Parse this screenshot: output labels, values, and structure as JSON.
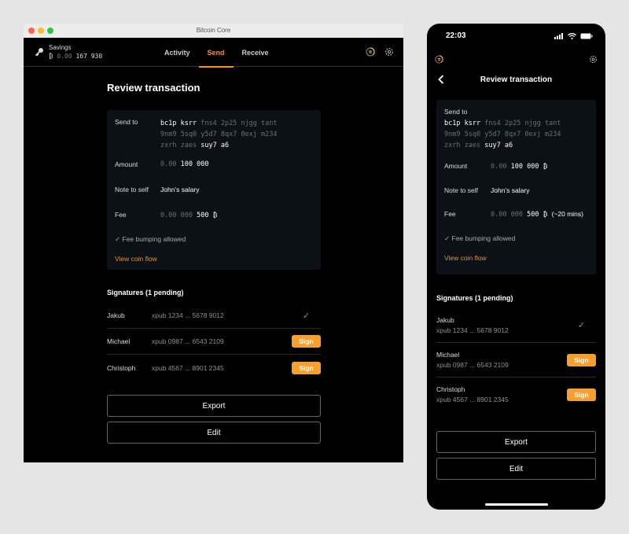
{
  "desktop": {
    "window_title": "Bitcoin Core",
    "wallet": {
      "name": "Savings",
      "balance_prefix": "₿",
      "balance_dim": "0.00",
      "balance_value": "167 930"
    },
    "tabs": [
      {
        "label": "Activity",
        "active": false
      },
      {
        "label": "Send",
        "active": true
      },
      {
        "label": "Receive",
        "active": false
      }
    ],
    "icons": {
      "network": "network-status-icon",
      "settings": "gear-icon"
    }
  },
  "phone": {
    "time": "22:03",
    "back_label": "‹"
  },
  "review": {
    "title": "Review transaction",
    "send_to_label": "Send to",
    "address": {
      "line1": [
        {
          "t": "bc1p",
          "hi": true
        },
        {
          "t": "ksrr",
          "hi": true
        },
        {
          "t": "fns4",
          "hi": false
        },
        {
          "t": "2p25",
          "hi": false
        },
        {
          "t": "njgg",
          "hi": false
        },
        {
          "t": "tant",
          "hi": false
        }
      ],
      "line2": [
        {
          "t": "9nm9",
          "hi": false
        },
        {
          "t": "5sq0",
          "hi": false
        },
        {
          "t": "y5d7",
          "hi": false
        },
        {
          "t": "8qx7",
          "hi": false
        },
        {
          "t": "0exj",
          "hi": false
        },
        {
          "t": "m234",
          "hi": false
        }
      ],
      "line3": [
        {
          "t": "zxrh",
          "hi": false
        },
        {
          "t": "zaes",
          "hi": false
        },
        {
          "t": "suy7",
          "hi": true
        },
        {
          "t": "a6",
          "hi": true
        }
      ]
    },
    "amount_label": "Amount",
    "amount_dim": "0.00",
    "amount_value": "100 000",
    "unit": "₿",
    "note_label": "Note to self",
    "note_value": "John’s salary",
    "fee_label": "Fee",
    "fee_dim": "0.00 000",
    "fee_value": "500",
    "fee_eta": "(~20 mins)",
    "fee_bumping": "Fee bumping allowed",
    "view_coin_flow": "View coin flow",
    "signatures_title": "Signatures (1 pending)",
    "signers": [
      {
        "name": "Jakub",
        "xpub": "xpub 1234 ... 5678 9012",
        "signed": true
      },
      {
        "name": "Michael",
        "xpub": "xpub 0987 ... 6543 2109",
        "signed": false
      },
      {
        "name": "Christoph",
        "xpub": "xpub 4567 ... 8901 2345",
        "signed": false
      }
    ],
    "sign_label": "Sign",
    "export_label": "Export",
    "edit_label": "Edit"
  },
  "colors": {
    "accent": "#f7931a",
    "sign_button": "#f7a030",
    "check": "#3fbf62",
    "card_bg": "#0c1117"
  }
}
